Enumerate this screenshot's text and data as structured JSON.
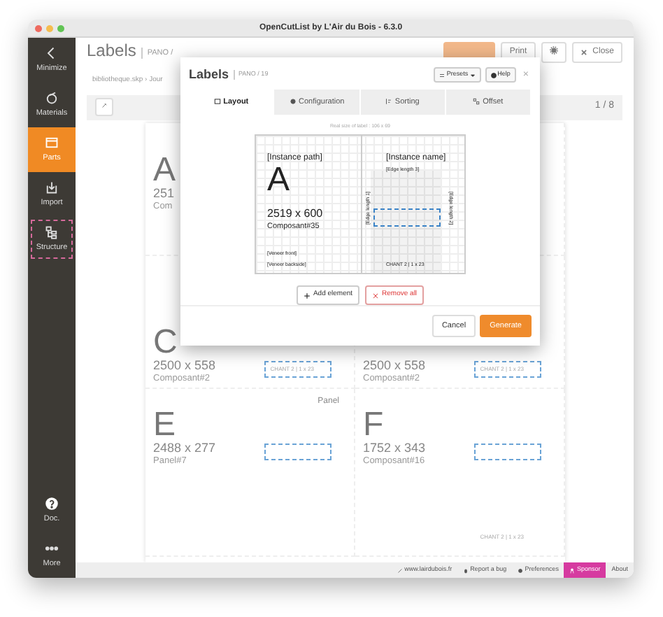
{
  "window": {
    "title": "OpenCutList by L'Air du Bois - 6.3.0"
  },
  "sidebar": {
    "items": [
      {
        "kind": "minimize",
        "label": "Minimize",
        "selected": false,
        "highlighted": false
      },
      {
        "kind": "materials",
        "label": "Materials",
        "selected": false,
        "highlighted": false
      },
      {
        "kind": "parts",
        "label": "Parts",
        "selected": true,
        "highlighted": false
      },
      {
        "kind": "import",
        "label": "Import",
        "selected": false,
        "highlighted": false
      },
      {
        "kind": "structure",
        "label": "Structure",
        "selected": false,
        "highlighted": true
      }
    ],
    "bottom_items": [
      {
        "kind": "doc",
        "label": "Doc."
      },
      {
        "kind": "more",
        "label": "More"
      }
    ]
  },
  "header": {
    "title": "Labels",
    "subtitle": "PANO /",
    "print": "Print",
    "close": "Close"
  },
  "breadcrumb": "bibliotheque.skp › Jour",
  "toolbar": {
    "pager": "1 / 8"
  },
  "sheet": {
    "rows": [
      [
        {
          "letter": "A",
          "size": "251",
          "name": "Com"
        },
        {}
      ],
      [
        {
          "letter": "C",
          "size": "2500 x 558",
          "name": "Composant#2",
          "edge": true,
          "footer": "CHANT 2 | 1 x 23"
        },
        {
          "size": "2500 x 558",
          "name": "Composant#2",
          "edge": true,
          "footer": "CHANT 2 | 1 x 23"
        }
      ],
      [
        {
          "top": "Panel",
          "letter": "E",
          "size": "2488 x 277",
          "name": "Panel#7",
          "edge": true
        },
        {
          "letter": "F",
          "size": "1752 x 343",
          "name": "Composant#16",
          "edge": true,
          "footer": "CHANT 2 | 1 x 23"
        }
      ]
    ]
  },
  "modal": {
    "title": "Labels",
    "subtitle": "PANO / 19",
    "presets": "Presets",
    "help": "Help",
    "close": "×",
    "tabs": [
      {
        "label": "Layout",
        "selected": true
      },
      {
        "label": "Configuration",
        "selected": false
      },
      {
        "label": "Sorting",
        "selected": false
      },
      {
        "label": "Offset",
        "selected": false
      }
    ],
    "real_size": "Real size of label : 106 x 69",
    "preview": {
      "instance_path": "[Instance path]",
      "instance_name": "[Instance name]",
      "edge_length": "[Edge length 3]",
      "letter": "A",
      "size": "2519 x 600",
      "name": "Composant#35",
      "edge_left": "[Edge length 1]",
      "edge_right": "[Edge length 2]",
      "veneer_front": "[Veneer front]",
      "veneer_back": "[Veneer backside]",
      "chant": "CHANT 2 | 1 x 23"
    },
    "add": "Add element",
    "remove": "Remove all",
    "cancel": "Cancel",
    "generate": "Generate"
  },
  "footer": {
    "links": [
      {
        "kind": "link",
        "label": "www.lairdubois.fr"
      },
      {
        "kind": "bug",
        "label": "Report a bug"
      },
      {
        "kind": "prefs",
        "label": "Preferences"
      },
      {
        "kind": "sponsor",
        "label": "Sponsor"
      },
      {
        "kind": "plain",
        "label": "About"
      }
    ]
  }
}
